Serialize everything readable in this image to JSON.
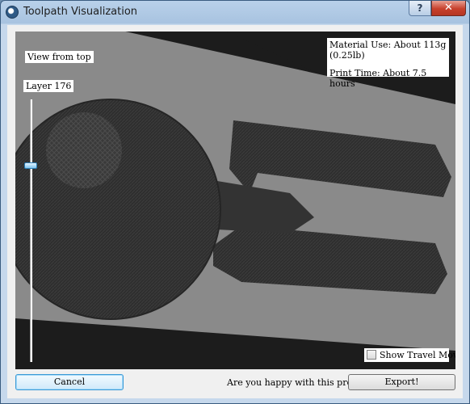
{
  "window": {
    "title": "Toolpath Visualization",
    "help_label": "?",
    "close_label": "✕"
  },
  "viewport": {
    "view_label": "View from top",
    "layer_label": "Layer 176",
    "material_use": "Material Use: About 113g (0.25lb)",
    "print_time": "Print Time: About 7.5 hours",
    "show_travel_moves": "Show Travel Moves",
    "show_travel_moves_checked": false
  },
  "footer": {
    "cancel_label": "Cancel",
    "question": "Are you happy with this preview?",
    "export_label": "Export!"
  },
  "colors": {
    "bed": "#8a8a8a",
    "bed_edge": "#1c1c1c",
    "model": "#2c2c2c",
    "accent": "#3c9ad6"
  }
}
